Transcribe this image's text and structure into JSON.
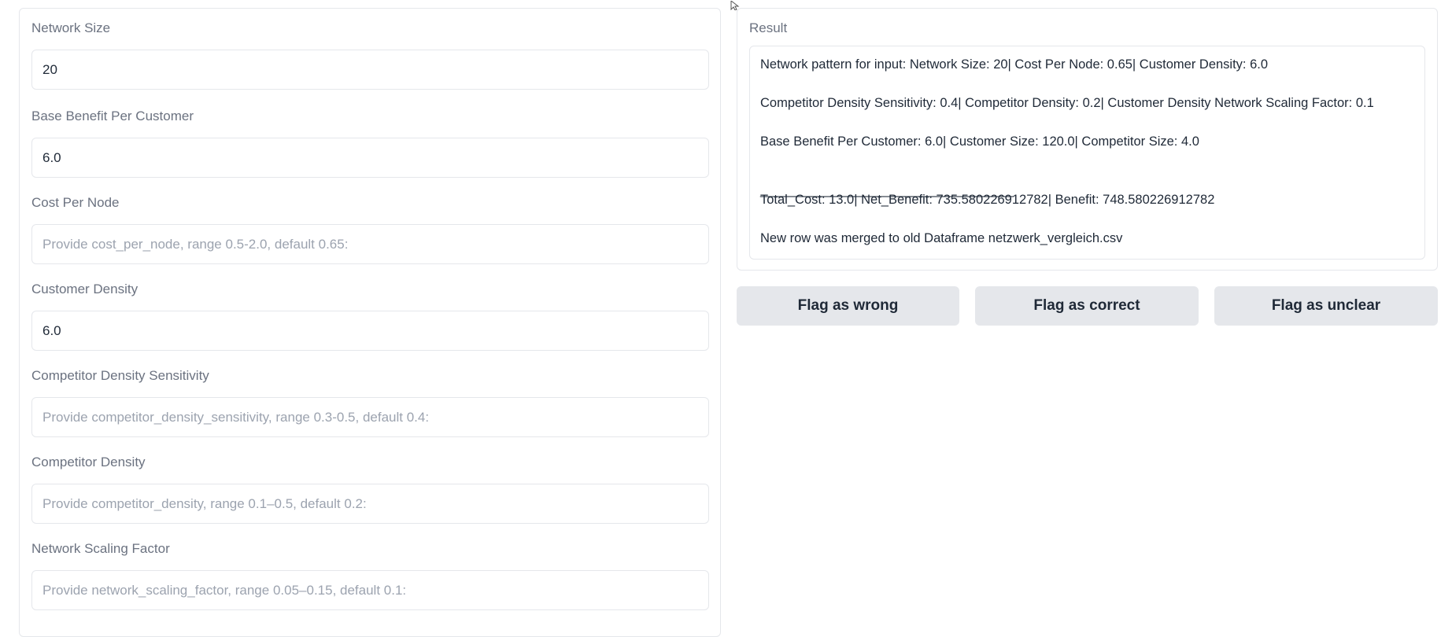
{
  "form": {
    "fields": [
      {
        "label": "Network Size",
        "value": "20",
        "placeholder": ""
      },
      {
        "label": "Base Benefit Per Customer",
        "value": "6.0",
        "placeholder": ""
      },
      {
        "label": "Cost Per Node",
        "value": "",
        "placeholder": "Provide cost_per_node, range 0.5-2.0, default 0.65:"
      },
      {
        "label": "Customer Density",
        "value": "6.0",
        "placeholder": ""
      },
      {
        "label": "Competitor Density Sensitivity",
        "value": "",
        "placeholder": "Provide competitor_density_sensitivity, range 0.3-0.5, default 0.4:"
      },
      {
        "label": "Competitor Density",
        "value": "",
        "placeholder": "Provide competitor_density, range 0.1–0.5, default 0.2:"
      },
      {
        "label": "Network Scaling Factor",
        "value": "",
        "placeholder": "Provide network_scaling_factor, range 0.05–0.15, default 0.1:"
      }
    ]
  },
  "result": {
    "label": "Result",
    "lines": [
      "Network pattern for input: Network Size: 20| Cost Per Node: 0.65| Customer Density: 6.0",
      "Competitor Density Sensitivity: 0.4| Competitor Density: 0.2| Customer Density Network Scaling Factor: 0.1",
      "Base Benefit Per Customer: 6.0| Customer Size: 120.0| Competitor Size: 4.0",
      "___________________________________",
      "Total_Cost: 13.0| Net_Benefit: 735.580226912782| Benefit: 748.580226912782",
      "New row was merged to old Dataframe netzwerk_vergleich.csv"
    ]
  },
  "actions": {
    "flag_wrong": "Flag as wrong",
    "flag_correct": "Flag as correct",
    "flag_unclear": "Flag as unclear"
  },
  "icons": {
    "cursor": "mouse-pointer-icon"
  }
}
